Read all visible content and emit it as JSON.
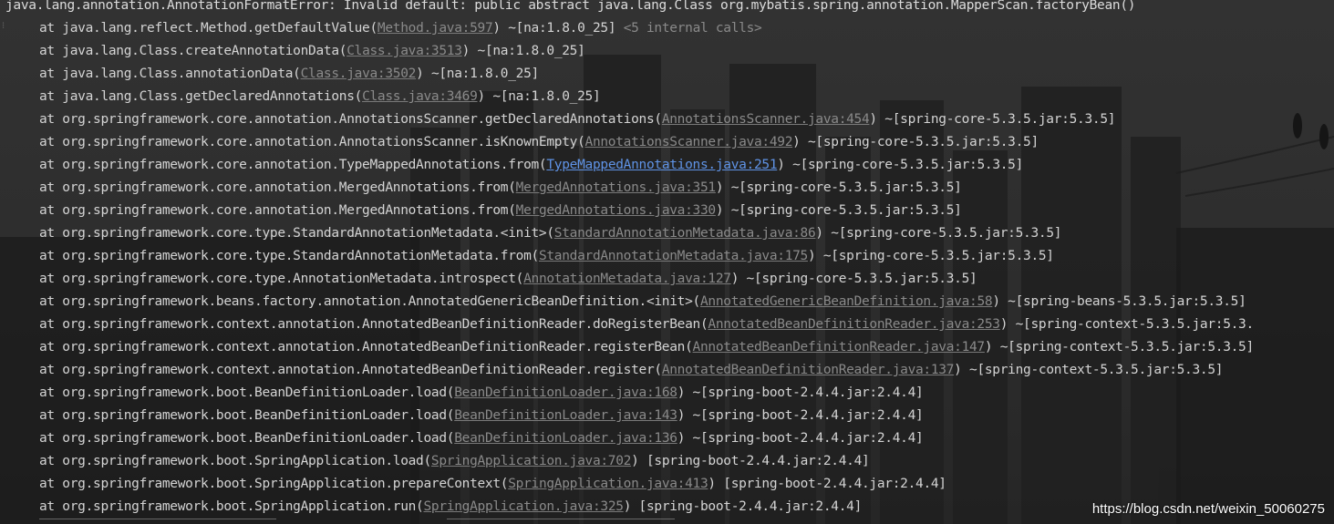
{
  "theme": {
    "bg": "#2b2b2b",
    "text": "#d4d4d4",
    "link": "#8a8a8a",
    "link_hot": "#5f93e6"
  },
  "console": {
    "error_line": "java.lang.annotation.AnnotationFormatError: Invalid default: public abstract java.lang.Class org.mybatis.spring.annotation.MapperScan.factoryBean()",
    "frames": [
      {
        "prefix": "at java.lang.reflect.Method.getDefaultValue(",
        "link": "Method.java:597",
        "suffix": ") ~[na:1.8.0_25]",
        "tail": " <5 internal calls>"
      },
      {
        "prefix": "at java.lang.Class.createAnnotationData(",
        "link": "Class.java:3513",
        "suffix": ") ~[na:1.8.0_25]"
      },
      {
        "prefix": "at java.lang.Class.annotationData(",
        "link": "Class.java:3502",
        "suffix": ") ~[na:1.8.0_25]"
      },
      {
        "prefix": "at java.lang.Class.getDeclaredAnnotations(",
        "link": "Class.java:3469",
        "suffix": ") ~[na:1.8.0_25]"
      },
      {
        "prefix": "at org.springframework.core.annotation.AnnotationsScanner.getDeclaredAnnotations(",
        "link": "AnnotationsScanner.java:454",
        "suffix": ") ~[spring-core-5.3.5.jar:5.3.5]"
      },
      {
        "prefix": "at org.springframework.core.annotation.AnnotationsScanner.isKnownEmpty(",
        "link": "AnnotationsScanner.java:492",
        "suffix": ") ~[spring-core-5.3.5.jar:5.3.5]"
      },
      {
        "prefix": "at org.springframework.core.annotation.TypeMappedAnnotations.from(",
        "link": "TypeMappedAnnotations.java:251",
        "suffix": ") ~[spring-core-5.3.5.jar:5.3.5]",
        "hot": true
      },
      {
        "prefix": "at org.springframework.core.annotation.MergedAnnotations.from(",
        "link": "MergedAnnotations.java:351",
        "suffix": ") ~[spring-core-5.3.5.jar:5.3.5]"
      },
      {
        "prefix": "at org.springframework.core.annotation.MergedAnnotations.from(",
        "link": "MergedAnnotations.java:330",
        "suffix": ") ~[spring-core-5.3.5.jar:5.3.5]"
      },
      {
        "prefix": "at org.springframework.core.type.StandardAnnotationMetadata.<init>(",
        "link": "StandardAnnotationMetadata.java:86",
        "suffix": ") ~[spring-core-5.3.5.jar:5.3.5]"
      },
      {
        "prefix": "at org.springframework.core.type.StandardAnnotationMetadata.from(",
        "link": "StandardAnnotationMetadata.java:175",
        "suffix": ") ~[spring-core-5.3.5.jar:5.3.5]"
      },
      {
        "prefix": "at org.springframework.core.type.AnnotationMetadata.introspect(",
        "link": "AnnotationMetadata.java:127",
        "suffix": ") ~[spring-core-5.3.5.jar:5.3.5]"
      },
      {
        "prefix": "at org.springframework.beans.factory.annotation.AnnotatedGenericBeanDefinition.<init>(",
        "link": "AnnotatedGenericBeanDefinition.java:58",
        "suffix": ") ~[spring-beans-5.3.5.jar:5.3.5]"
      },
      {
        "prefix": "at org.springframework.context.annotation.AnnotatedBeanDefinitionReader.doRegisterBean(",
        "link": "AnnotatedBeanDefinitionReader.java:253",
        "suffix": ") ~[spring-context-5.3.5.jar:5.3."
      },
      {
        "prefix": "at org.springframework.context.annotation.AnnotatedBeanDefinitionReader.registerBean(",
        "link": "AnnotatedBeanDefinitionReader.java:147",
        "suffix": ") ~[spring-context-5.3.5.jar:5.3.5]"
      },
      {
        "prefix": "at org.springframework.context.annotation.AnnotatedBeanDefinitionReader.register(",
        "link": "AnnotatedBeanDefinitionReader.java:137",
        "suffix": ") ~[spring-context-5.3.5.jar:5.3.5]"
      },
      {
        "prefix": "at org.springframework.boot.BeanDefinitionLoader.load(",
        "link": "BeanDefinitionLoader.java:168",
        "suffix": ") ~[spring-boot-2.4.4.jar:2.4.4]"
      },
      {
        "prefix": "at org.springframework.boot.BeanDefinitionLoader.load(",
        "link": "BeanDefinitionLoader.java:143",
        "suffix": ") ~[spring-boot-2.4.4.jar:2.4.4]"
      },
      {
        "prefix": "at org.springframework.boot.BeanDefinitionLoader.load(",
        "link": "BeanDefinitionLoader.java:136",
        "suffix": ") ~[spring-boot-2.4.4.jar:2.4.4]"
      },
      {
        "prefix": "at org.springframework.boot.SpringApplication.load(",
        "link": "SpringApplication.java:702",
        "suffix": ") [spring-boot-2.4.4.jar:2.4.4]"
      },
      {
        "prefix": "at org.springframework.boot.SpringApplication.prepareContext(",
        "link": "SpringApplication.java:413",
        "suffix": ") [spring-boot-2.4.4.jar:2.4.4]"
      },
      {
        "prefix": "at org.springframework.boot.SpringApplication.run(",
        "link": "SpringApplication.java:325",
        "suffix": ") [spring-boot-2.4.4.jar:2.4.4]"
      }
    ]
  },
  "watermark": "https://blog.csdn.net/weixin_50060275"
}
